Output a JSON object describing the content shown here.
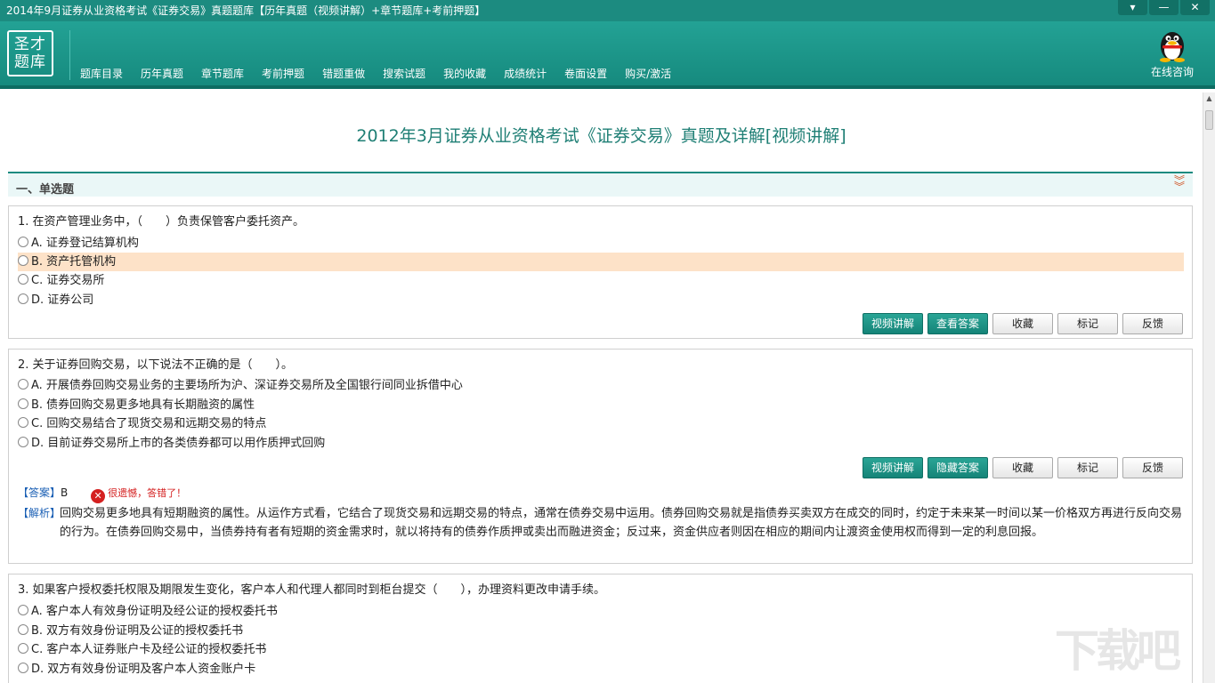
{
  "window": {
    "title": "2014年9月证券从业资格考试《证券交易》真题题库【历年真题（视频讲解）+章节题库+考前押题】",
    "controls": {
      "menu": "▾",
      "minimize": "—",
      "close": "✕"
    }
  },
  "logo": {
    "line1": "圣才",
    "line2": "题库"
  },
  "nav": {
    "items": [
      "题库目录",
      "历年真题",
      "章节题库",
      "考前押题",
      "错题重做",
      "搜索试题",
      "我的收藏",
      "成绩统计",
      "卷面设置",
      "购买/激活"
    ],
    "consult_label": "在线咨询"
  },
  "paper_title": "2012年3月证券从业资格考试《证券交易》真题及详解[视频讲解]",
  "section": {
    "label": "一、单选题"
  },
  "questions": [
    {
      "text": "1. 在资产管理业务中，（　　）负责保管客户委托资产。",
      "options": [
        "A. 证券登记结算机构",
        "B. 资产托管机构",
        "C. 证券交易所",
        "D. 证券公司"
      ],
      "selected": 1,
      "buttons": [
        "视频讲解",
        "查看答案",
        "收藏",
        "标记",
        "反馈"
      ]
    },
    {
      "text": "2. 关于证券回购交易，以下说法不正确的是（　　）。",
      "options": [
        "A. 开展债券回购交易业务的主要场所为沪、深证券交易所及全国银行间同业拆借中心",
        "B. 债券回购交易更多地具有长期融资的属性",
        "C. 回购交易结合了现货交易和远期交易的特点",
        "D. 目前证券交易所上市的各类债券都可以用作质押式回购"
      ],
      "buttons": [
        "视频讲解",
        "隐藏答案",
        "收藏",
        "标记",
        "反馈"
      ],
      "answer_tag": "【答案】",
      "answer": "B",
      "result_text": "很遗憾，答错了！",
      "analysis_tag": "【解析】",
      "analysis": "回购交易更多地具有短期融资的属性。从运作方式看，它结合了现货交易和远期交易的特点，通常在债券交易中运用。债券回购交易就是指债券买卖双方在成交的同时，约定于未来某一时间以某一价格双方再进行反向交易的行为。在债券回购交易中，当债券持有者有短期的资金需求时，就以将持有的债券作质押或卖出而融进资金；反过来，资金供应者则因在相应的期间内让渡资金使用权而得到一定的利息回报。"
    },
    {
      "text": "3. 如果客户授权委托权限及期限发生变化，客户本人和代理人都同时到柜台提交（　　），办理资料更改申请手续。",
      "options": [
        "A. 客户本人有效身份证明及经公证的授权委托书",
        "B. 双方有效身份证明及公证的授权委托书",
        "C. 客户本人证券账户卡及经公证的授权委托书",
        "D. 双方有效身份证明及客户本人资金账户卡"
      ]
    }
  ],
  "watermark": "下载吧",
  "colors": {
    "primary": "#1c8b80",
    "selected_option": "#fde2c8",
    "error": "#d42020",
    "tag": "#1a5fb4"
  }
}
